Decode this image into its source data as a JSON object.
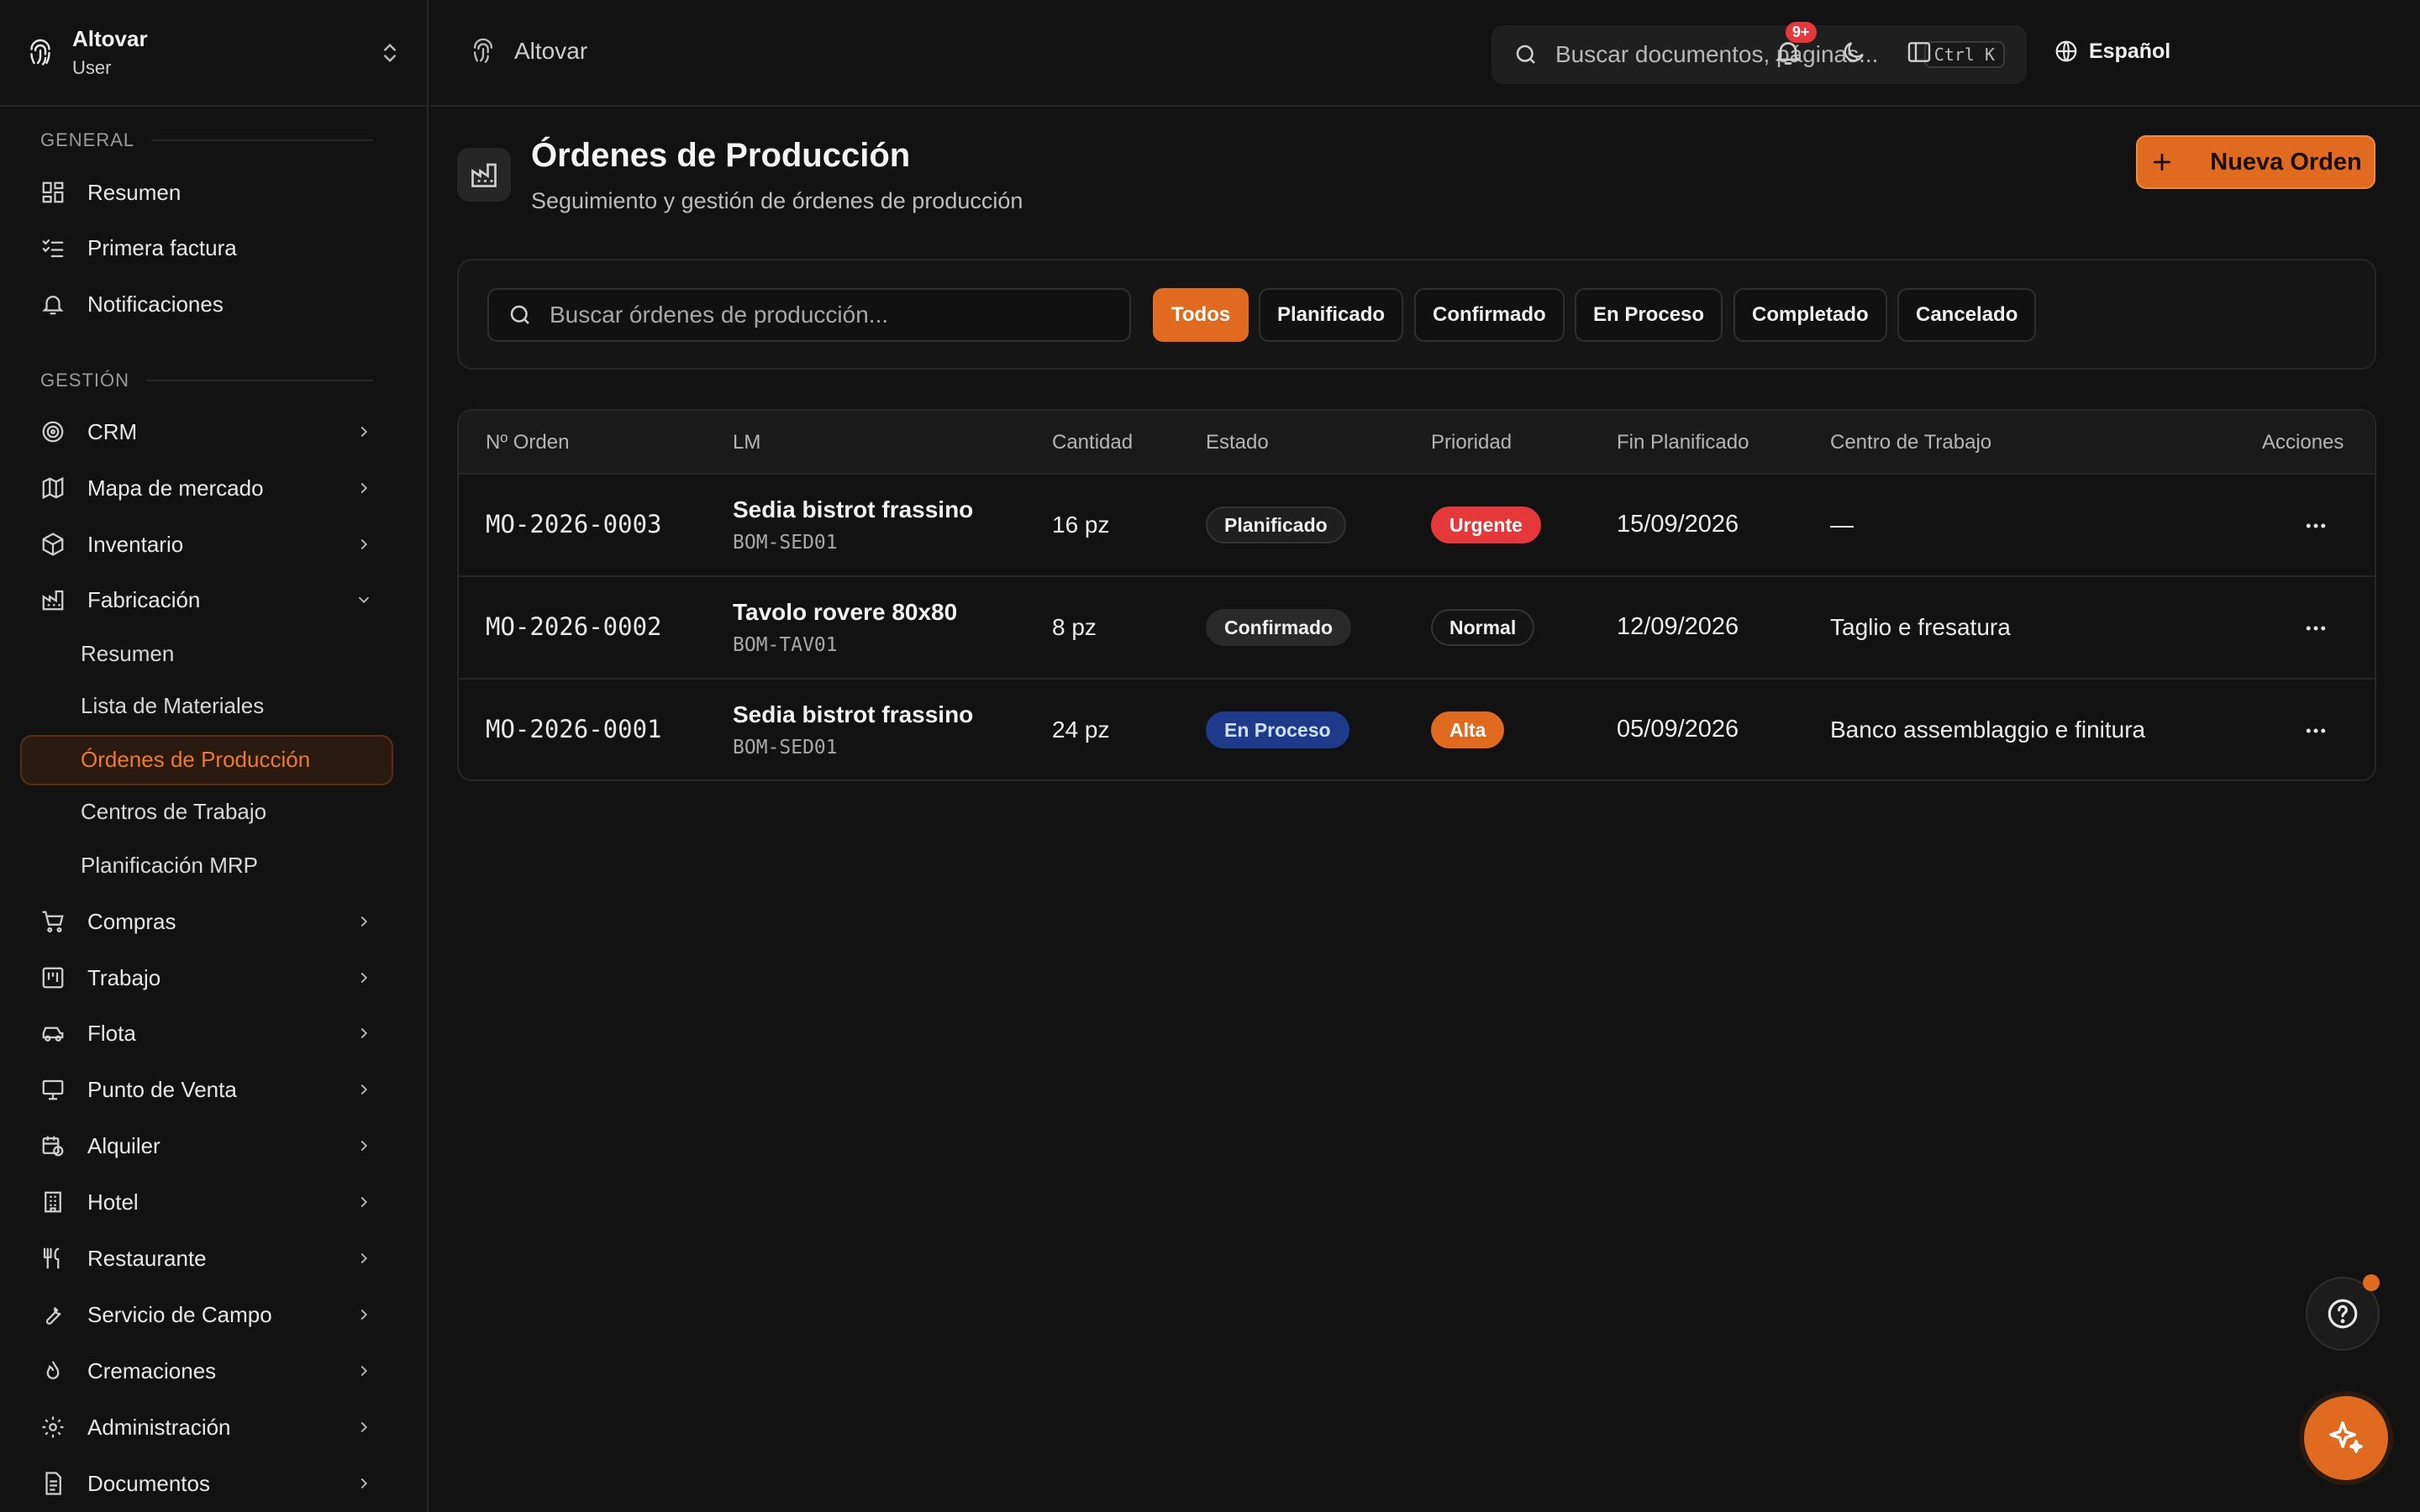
{
  "workspace": {
    "name": "Altovar",
    "role": "User"
  },
  "sidebar": {
    "section_general": "GENERAL",
    "general_items": [
      {
        "label": "Resumen",
        "icon": "dashboard-icon"
      },
      {
        "label": "Primera factura",
        "icon": "checklist-icon"
      },
      {
        "label": "Notificaciones",
        "icon": "bell-icon"
      }
    ],
    "section_management": "GESTIÓN",
    "management_items": [
      {
        "label": "CRM",
        "icon": "target-icon"
      },
      {
        "label": "Mapa de mercado",
        "icon": "map-icon"
      },
      {
        "label": "Inventario",
        "icon": "box-icon"
      },
      {
        "label": "Fabricación",
        "icon": "factory-icon",
        "expanded": true
      }
    ],
    "fabrication_sub": [
      {
        "label": "Resumen"
      },
      {
        "label": "Lista de Materiales"
      },
      {
        "label": "Órdenes de Producción",
        "active": true
      },
      {
        "label": "Centros de Trabajo"
      },
      {
        "label": "Planificación MRP"
      }
    ],
    "more_items": [
      {
        "label": "Compras",
        "icon": "cart-icon"
      },
      {
        "label": "Trabajo",
        "icon": "kanban-icon"
      },
      {
        "label": "Flota",
        "icon": "car-icon"
      },
      {
        "label": "Punto de Venta",
        "icon": "monitor-icon"
      },
      {
        "label": "Alquiler",
        "icon": "calendar-clock-icon"
      },
      {
        "label": "Hotel",
        "icon": "building-icon"
      },
      {
        "label": "Restaurante",
        "icon": "utensils-icon"
      },
      {
        "label": "Servicio de Campo",
        "icon": "wrench-icon"
      },
      {
        "label": "Cremaciones",
        "icon": "flame-icon"
      },
      {
        "label": "Administración",
        "icon": "settings-icon"
      },
      {
        "label": "Documentos",
        "icon": "document-icon"
      }
    ]
  },
  "topbar": {
    "breadcrumb": "Altovar",
    "search_placeholder": "Buscar documentos, páginas...",
    "search_shortcut": "Ctrl K",
    "language": "Español",
    "notifications_badge": "9+"
  },
  "header": {
    "title": "Órdenes de Producción",
    "subtitle": "Seguimiento y gestión de órdenes de producción",
    "new_button": "Nueva Orden"
  },
  "filters": {
    "search_placeholder": "Buscar órdenes de producción...",
    "chips": [
      "Todos",
      "Planificado",
      "Confirmado",
      "En Proceso",
      "Completado",
      "Cancelado"
    ],
    "active": "Todos"
  },
  "table": {
    "columns": [
      "Nº Orden",
      "LM",
      "Cantidad",
      "Estado",
      "Prioridad",
      "Fin Planificado",
      "Centro de Trabajo",
      "Acciones"
    ],
    "rows": [
      {
        "order": "MO-2026-0003",
        "lm_name": "Sedia bistrot frassino",
        "lm_code": "BOM-SED01",
        "qty": "16 pz",
        "status": "Planificado",
        "priority": "Urgente",
        "end": "15/09/2026",
        "center": "—"
      },
      {
        "order": "MO-2026-0002",
        "lm_name": "Tavolo rovere 80x80",
        "lm_code": "BOM-TAV01",
        "qty": "8 pz",
        "status": "Confirmado",
        "priority": "Normal",
        "end": "12/09/2026",
        "center": "Taglio e fresatura"
      },
      {
        "order": "MO-2026-0001",
        "lm_name": "Sedia bistrot frassino",
        "lm_code": "BOM-SED01",
        "qty": "24 pz",
        "status": "En Proceso",
        "priority": "Alta",
        "end": "05/09/2026",
        "center": "Banco assemblaggio e finitura"
      }
    ]
  },
  "colors": {
    "accent": "#e06a1f",
    "urgent": "#e5383b",
    "in_process": "#1e3a8a"
  }
}
